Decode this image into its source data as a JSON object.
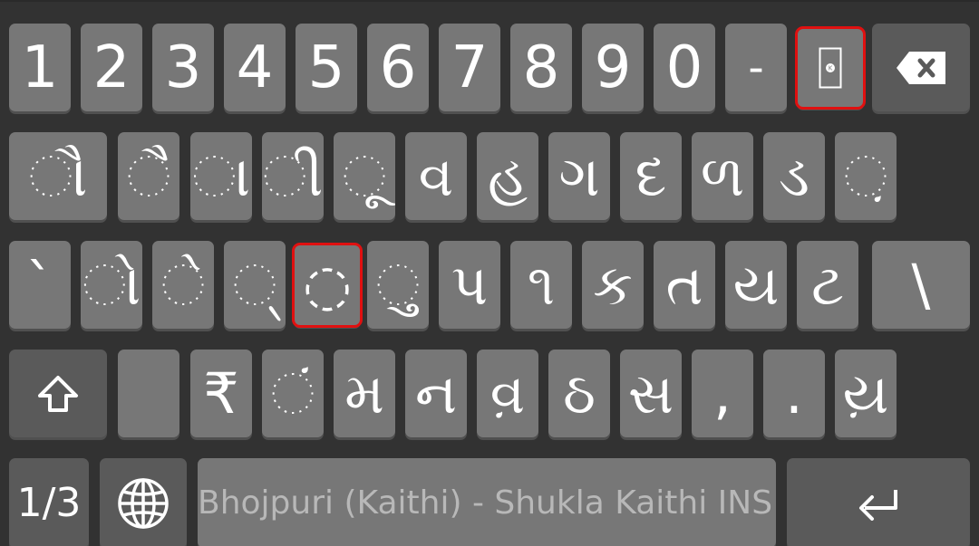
{
  "rows": {
    "row1": [
      {
        "label": "1"
      },
      {
        "label": "2"
      },
      {
        "label": "3"
      },
      {
        "label": "4"
      },
      {
        "label": "5"
      },
      {
        "label": "6"
      },
      {
        "label": "7"
      },
      {
        "label": "8"
      },
      {
        "label": "9"
      },
      {
        "label": "0"
      },
      {
        "label": "-"
      }
    ],
    "row2": [
      {
        "label": "◌ૌ"
      },
      {
        "label": "◌ૈ"
      },
      {
        "label": "◌ા"
      },
      {
        "label": "◌ી"
      },
      {
        "label": "◌ૂ"
      },
      {
        "label": "વ"
      },
      {
        "label": "હ"
      },
      {
        "label": "ગ"
      },
      {
        "label": "દ"
      },
      {
        "label": "ળ"
      },
      {
        "label": "ડ"
      },
      {
        "label": "◌઼"
      }
    ],
    "row3": [
      {
        "label": "`"
      },
      {
        "label": "◌ો"
      },
      {
        "label": "◌ે"
      },
      {
        "label": "્"
      },
      {
        "label": "◌"
      },
      {
        "label": "◌ુ"
      },
      {
        "label": "પ"
      },
      {
        "label": "૧"
      },
      {
        "label": "ક"
      },
      {
        "label": "ત"
      },
      {
        "label": "ય"
      },
      {
        "label": "ટ"
      },
      {
        "label": "\\"
      }
    ],
    "row4": [
      {
        "label": ""
      },
      {
        "label": "₹"
      },
      {
        "label": "◌ં"
      },
      {
        "label": "મ"
      },
      {
        "label": "ન"
      },
      {
        "label": "વ઼"
      },
      {
        "label": "ઠ"
      },
      {
        "label": "સ"
      },
      {
        "label": ","
      },
      {
        "label": "."
      },
      {
        "label": "ય઼"
      }
    ]
  },
  "bottom": {
    "layout_label": "1/3",
    "space_label": "Bhojpuri (Kaithi) - Shukla Kaithi INS"
  },
  "icons": {
    "backspace": "backspace-icon",
    "shift": "shift-icon",
    "globe": "globe-icon",
    "enter": "enter-icon",
    "kaithi_char": "kaithi-char-icon"
  },
  "colors": {
    "background": "#323232",
    "key": "#777777",
    "key_dark": "#5a5a5a",
    "highlight": "#e01010",
    "space_text": "#b8b8b8"
  }
}
